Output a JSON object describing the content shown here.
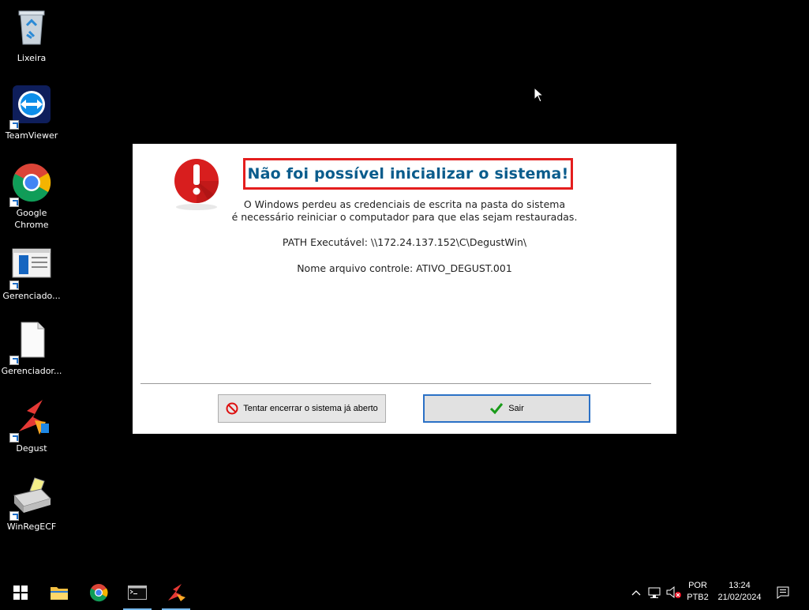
{
  "desktop": {
    "icons": [
      {
        "label": "Lixeira"
      },
      {
        "label": "TeamViewer"
      },
      {
        "label": "Google Chrome"
      },
      {
        "label": "Gerenciado..."
      },
      {
        "label": "Gerenciador..."
      },
      {
        "label": "Degust"
      },
      {
        "label": "WinRegECF"
      }
    ]
  },
  "dialog": {
    "title": "Não foi possível inicializar o sistema!",
    "line1": "O Windows perdeu as credenciais de escrita na pasta do sistema",
    "line2": "é necessário reiniciar o computador para que elas sejam restauradas.",
    "path": "PATH Executável: \\\\172.24.137.152\\C\\DegustWin\\",
    "control": "Nome arquivo controle: ATIVO_DEGUST.001",
    "btn_try": "Tentar encerrar o sistema já aberto",
    "btn_exit": "Sair",
    "colors": {
      "title": "#0a5c8c",
      "title_border": "#e41e1e",
      "alert": "#d81e1e"
    }
  },
  "taskbar": {
    "items": [
      {
        "icon": "windows-start-icon"
      },
      {
        "icon": "file-explorer-icon"
      },
      {
        "icon": "chrome-icon"
      },
      {
        "icon": "command-prompt-icon"
      },
      {
        "icon": "degust-icon"
      }
    ],
    "tray": {
      "lang_top": "POR",
      "lang_bottom": "PTB2",
      "time": "13:24",
      "date": "21/02/2024"
    }
  }
}
